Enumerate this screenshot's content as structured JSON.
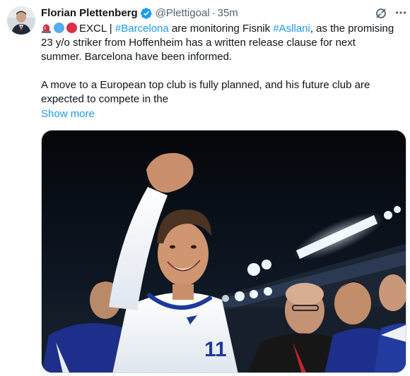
{
  "author": {
    "display_name": "Florian Plettenberg",
    "handle": "@Plettigoal",
    "separator": "·",
    "time": "35m"
  },
  "icons": {
    "avatar": "profile-photo",
    "verified": "verified-badge-icon",
    "grok": "grok-icon",
    "more": "more-horizontal-icon",
    "emoji_1": "rotating-light-emoji",
    "emoji_2": "blue-circle-emoji",
    "emoji_3": "red-circle-emoji"
  },
  "colors": {
    "link": "#1d9bf0",
    "text": "#0f1419",
    "muted": "#536471",
    "verified": "#1d9bf0"
  },
  "post": {
    "line1_pre": "EXCL | ",
    "hashtag_1": "#Barcelona",
    "line1_mid": " are monitoring Fisnik ",
    "hashtag_2": "#Asllani",
    "line1_post": ", as the promising 23 y/o striker from Hoffenheim has a written release clause for next summer. Barcelona have been informed.",
    "paragraph_2": "A move to a European top club is fully planned, and his future club are expected to compete in the",
    "show_more": "Show more"
  },
  "media": {
    "shirt_number": "11"
  }
}
